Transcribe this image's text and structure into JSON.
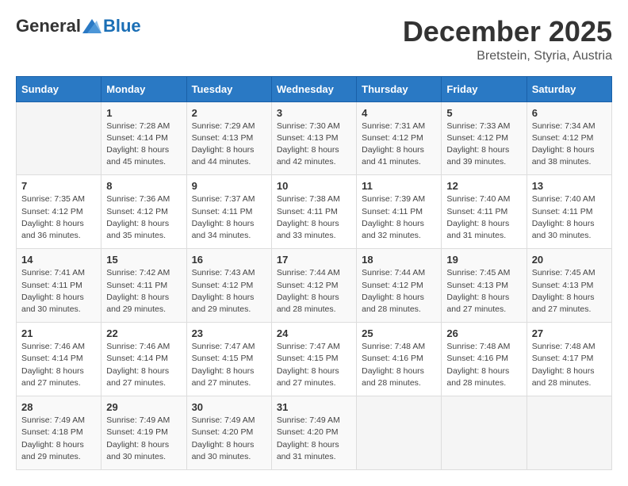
{
  "header": {
    "logo_general": "General",
    "logo_blue": "Blue",
    "month_title": "December 2025",
    "location": "Bretstein, Styria, Austria"
  },
  "days_of_week": [
    "Sunday",
    "Monday",
    "Tuesday",
    "Wednesday",
    "Thursday",
    "Friday",
    "Saturday"
  ],
  "weeks": [
    [
      {
        "day": "",
        "sunrise": "",
        "sunset": "",
        "daylight": ""
      },
      {
        "day": "1",
        "sunrise": "Sunrise: 7:28 AM",
        "sunset": "Sunset: 4:14 PM",
        "daylight": "Daylight: 8 hours and 45 minutes."
      },
      {
        "day": "2",
        "sunrise": "Sunrise: 7:29 AM",
        "sunset": "Sunset: 4:13 PM",
        "daylight": "Daylight: 8 hours and 44 minutes."
      },
      {
        "day": "3",
        "sunrise": "Sunrise: 7:30 AM",
        "sunset": "Sunset: 4:13 PM",
        "daylight": "Daylight: 8 hours and 42 minutes."
      },
      {
        "day": "4",
        "sunrise": "Sunrise: 7:31 AM",
        "sunset": "Sunset: 4:12 PM",
        "daylight": "Daylight: 8 hours and 41 minutes."
      },
      {
        "day": "5",
        "sunrise": "Sunrise: 7:33 AM",
        "sunset": "Sunset: 4:12 PM",
        "daylight": "Daylight: 8 hours and 39 minutes."
      },
      {
        "day": "6",
        "sunrise": "Sunrise: 7:34 AM",
        "sunset": "Sunset: 4:12 PM",
        "daylight": "Daylight: 8 hours and 38 minutes."
      }
    ],
    [
      {
        "day": "7",
        "sunrise": "Sunrise: 7:35 AM",
        "sunset": "Sunset: 4:12 PM",
        "daylight": "Daylight: 8 hours and 36 minutes."
      },
      {
        "day": "8",
        "sunrise": "Sunrise: 7:36 AM",
        "sunset": "Sunset: 4:12 PM",
        "daylight": "Daylight: 8 hours and 35 minutes."
      },
      {
        "day": "9",
        "sunrise": "Sunrise: 7:37 AM",
        "sunset": "Sunset: 4:11 PM",
        "daylight": "Daylight: 8 hours and 34 minutes."
      },
      {
        "day": "10",
        "sunrise": "Sunrise: 7:38 AM",
        "sunset": "Sunset: 4:11 PM",
        "daylight": "Daylight: 8 hours and 33 minutes."
      },
      {
        "day": "11",
        "sunrise": "Sunrise: 7:39 AM",
        "sunset": "Sunset: 4:11 PM",
        "daylight": "Daylight: 8 hours and 32 minutes."
      },
      {
        "day": "12",
        "sunrise": "Sunrise: 7:40 AM",
        "sunset": "Sunset: 4:11 PM",
        "daylight": "Daylight: 8 hours and 31 minutes."
      },
      {
        "day": "13",
        "sunrise": "Sunrise: 7:40 AM",
        "sunset": "Sunset: 4:11 PM",
        "daylight": "Daylight: 8 hours and 30 minutes."
      }
    ],
    [
      {
        "day": "14",
        "sunrise": "Sunrise: 7:41 AM",
        "sunset": "Sunset: 4:11 PM",
        "daylight": "Daylight: 8 hours and 30 minutes."
      },
      {
        "day": "15",
        "sunrise": "Sunrise: 7:42 AM",
        "sunset": "Sunset: 4:11 PM",
        "daylight": "Daylight: 8 hours and 29 minutes."
      },
      {
        "day": "16",
        "sunrise": "Sunrise: 7:43 AM",
        "sunset": "Sunset: 4:12 PM",
        "daylight": "Daylight: 8 hours and 29 minutes."
      },
      {
        "day": "17",
        "sunrise": "Sunrise: 7:44 AM",
        "sunset": "Sunset: 4:12 PM",
        "daylight": "Daylight: 8 hours and 28 minutes."
      },
      {
        "day": "18",
        "sunrise": "Sunrise: 7:44 AM",
        "sunset": "Sunset: 4:12 PM",
        "daylight": "Daylight: 8 hours and 28 minutes."
      },
      {
        "day": "19",
        "sunrise": "Sunrise: 7:45 AM",
        "sunset": "Sunset: 4:13 PM",
        "daylight": "Daylight: 8 hours and 27 minutes."
      },
      {
        "day": "20",
        "sunrise": "Sunrise: 7:45 AM",
        "sunset": "Sunset: 4:13 PM",
        "daylight": "Daylight: 8 hours and 27 minutes."
      }
    ],
    [
      {
        "day": "21",
        "sunrise": "Sunrise: 7:46 AM",
        "sunset": "Sunset: 4:14 PM",
        "daylight": "Daylight: 8 hours and 27 minutes."
      },
      {
        "day": "22",
        "sunrise": "Sunrise: 7:46 AM",
        "sunset": "Sunset: 4:14 PM",
        "daylight": "Daylight: 8 hours and 27 minutes."
      },
      {
        "day": "23",
        "sunrise": "Sunrise: 7:47 AM",
        "sunset": "Sunset: 4:15 PM",
        "daylight": "Daylight: 8 hours and 27 minutes."
      },
      {
        "day": "24",
        "sunrise": "Sunrise: 7:47 AM",
        "sunset": "Sunset: 4:15 PM",
        "daylight": "Daylight: 8 hours and 27 minutes."
      },
      {
        "day": "25",
        "sunrise": "Sunrise: 7:48 AM",
        "sunset": "Sunset: 4:16 PM",
        "daylight": "Daylight: 8 hours and 28 minutes."
      },
      {
        "day": "26",
        "sunrise": "Sunrise: 7:48 AM",
        "sunset": "Sunset: 4:16 PM",
        "daylight": "Daylight: 8 hours and 28 minutes."
      },
      {
        "day": "27",
        "sunrise": "Sunrise: 7:48 AM",
        "sunset": "Sunset: 4:17 PM",
        "daylight": "Daylight: 8 hours and 28 minutes."
      }
    ],
    [
      {
        "day": "28",
        "sunrise": "Sunrise: 7:49 AM",
        "sunset": "Sunset: 4:18 PM",
        "daylight": "Daylight: 8 hours and 29 minutes."
      },
      {
        "day": "29",
        "sunrise": "Sunrise: 7:49 AM",
        "sunset": "Sunset: 4:19 PM",
        "daylight": "Daylight: 8 hours and 30 minutes."
      },
      {
        "day": "30",
        "sunrise": "Sunrise: 7:49 AM",
        "sunset": "Sunset: 4:20 PM",
        "daylight": "Daylight: 8 hours and 30 minutes."
      },
      {
        "day": "31",
        "sunrise": "Sunrise: 7:49 AM",
        "sunset": "Sunset: 4:20 PM",
        "daylight": "Daylight: 8 hours and 31 minutes."
      },
      {
        "day": "",
        "sunrise": "",
        "sunset": "",
        "daylight": ""
      },
      {
        "day": "",
        "sunrise": "",
        "sunset": "",
        "daylight": ""
      },
      {
        "day": "",
        "sunrise": "",
        "sunset": "",
        "daylight": ""
      }
    ]
  ]
}
